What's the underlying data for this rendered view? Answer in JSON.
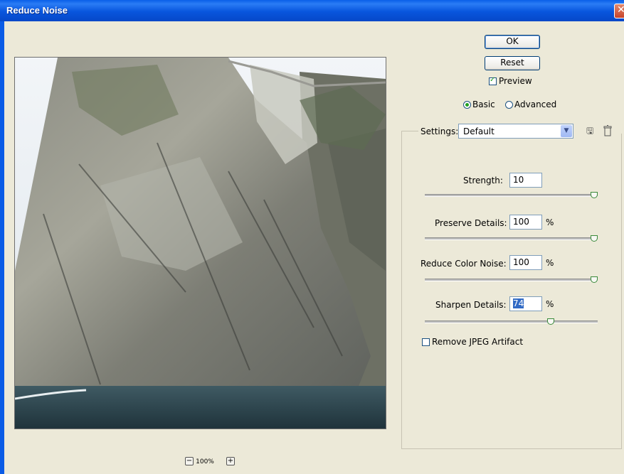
{
  "window": {
    "title": "Reduce Noise"
  },
  "buttons": {
    "ok": "OK",
    "reset": "Reset"
  },
  "preview_checkbox": {
    "label": "Preview",
    "checked": true
  },
  "mode": {
    "basic_label": "Basic",
    "advanced_label": "Advanced",
    "selected": "Basic"
  },
  "settings": {
    "label": "Settings:",
    "selected": "Default"
  },
  "controls": {
    "strength": {
      "label": "Strength:",
      "value": "10",
      "unit": "",
      "level": 1.0
    },
    "preserve_details": {
      "label": "Preserve Details:",
      "value": "100",
      "unit": "%",
      "level": 1.0
    },
    "reduce_color_noise": {
      "label": "Reduce Color Noise:",
      "value": "100",
      "unit": "%",
      "level": 1.0
    },
    "sharpen_details": {
      "label": "Sharpen Details:",
      "value": "74",
      "unit": "%",
      "level": 0.74
    }
  },
  "remove_jpeg": {
    "label": "Remove JPEG Artifact",
    "checked": false
  },
  "zoom": {
    "level": "100%"
  },
  "icons": {
    "close": "close-icon",
    "save_settings": "save-settings-icon",
    "delete_settings": "trash-icon",
    "zoom_out": "minus-icon",
    "zoom_in": "plus-icon",
    "dropdown": "chevron-down-icon"
  },
  "colors": {
    "titlebar": "#0855dd",
    "dialog_bg": "#ece9d8",
    "check_mark": "#21a121",
    "selection": "#316ac5"
  }
}
